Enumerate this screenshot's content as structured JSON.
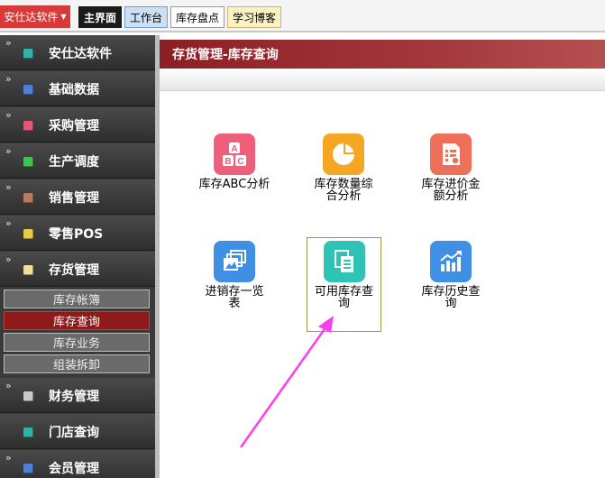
{
  "topbar": {
    "app_menu_label": "安仕达软件",
    "tabs": [
      {
        "label": "主界面"
      },
      {
        "label": "工作台"
      },
      {
        "label": "库存盘点"
      },
      {
        "label": "学习博客"
      }
    ]
  },
  "sidebar": {
    "items": [
      {
        "label": "安仕达软件",
        "icon": "teal-square-icon",
        "color": "#2fb3a6"
      },
      {
        "label": "基础数据",
        "icon": "blue-square-icon",
        "color": "#4f7fd6"
      },
      {
        "label": "采购管理",
        "icon": "pink-square-icon",
        "color": "#e0577a"
      },
      {
        "label": "生产调度",
        "icon": "green-square-icon",
        "color": "#3ec255"
      },
      {
        "label": "销售管理",
        "icon": "brown-square-icon",
        "color": "#b97a63"
      },
      {
        "label": "零售POS",
        "icon": "yellow-square-icon",
        "color": "#e9c94a"
      },
      {
        "label": "存货管理",
        "icon": "lightyellow-square-icon",
        "color": "#f1de9a"
      },
      {
        "label": "财务管理",
        "icon": "gray-square-icon",
        "color": "#c9c9c9"
      },
      {
        "label": "门店查询",
        "icon": "teal-square-icon",
        "color": "#2fb3a6"
      },
      {
        "label": "会员管理",
        "icon": "blue-square-icon",
        "color": "#4f7fd6"
      }
    ],
    "sub_items": [
      {
        "label": "库存帐簿"
      },
      {
        "label": "库存查询"
      },
      {
        "label": "库存业务"
      },
      {
        "label": "组装拆卸"
      }
    ]
  },
  "content": {
    "title": "存货管理-库存查询",
    "tiles": [
      {
        "line1": "库存ABC分析",
        "line2": "",
        "icon": "abc-analysis-icon",
        "color": "#ee5f7c"
      },
      {
        "line1": "库存数量综",
        "line2": "合分析",
        "icon": "pie-chart-icon",
        "color": "#f5a623"
      },
      {
        "line1": "库存进价金",
        "line2": "额分析",
        "icon": "report-document-icon",
        "color": "#ee6f5a"
      },
      {
        "line1": "进销存一览",
        "line2": "表",
        "icon": "layered-images-icon",
        "color": "#3f8fe4"
      },
      {
        "line1": "可用库存查",
        "line2": "询",
        "icon": "document-list-icon",
        "color": "#2ec3b5"
      },
      {
        "line1": "库存历史查",
        "line2": "询",
        "icon": "growth-chart-icon",
        "color": "#3f8fe4"
      }
    ]
  },
  "colors": {
    "accent_red": "#d83a3a",
    "header_red": "#8c1f24",
    "active_sub": "#8e1a1a",
    "annotation_arrow": "#ff3cf0"
  }
}
